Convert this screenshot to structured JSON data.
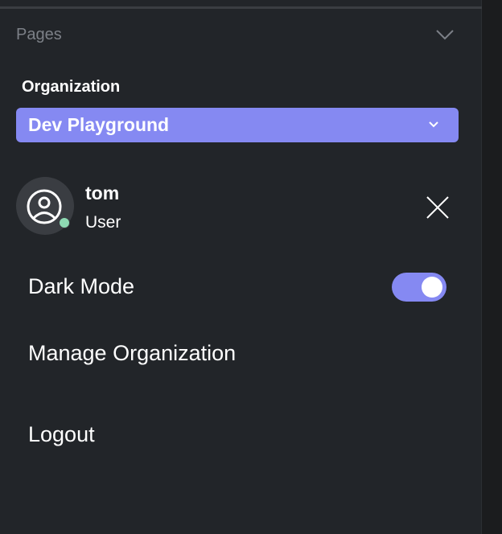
{
  "sidebar": {
    "pages_label": "Pages"
  },
  "organization": {
    "label": "Organization",
    "selected": "Dev Playground"
  },
  "user": {
    "name": "tom",
    "role": "User",
    "status_color": "#8ed9b3"
  },
  "menu": {
    "dark_mode": "Dark Mode",
    "dark_mode_on": true,
    "manage_org": "Manage Organization",
    "logout": "Logout"
  },
  "colors": {
    "accent": "#8589f2",
    "panel": "#222529"
  }
}
